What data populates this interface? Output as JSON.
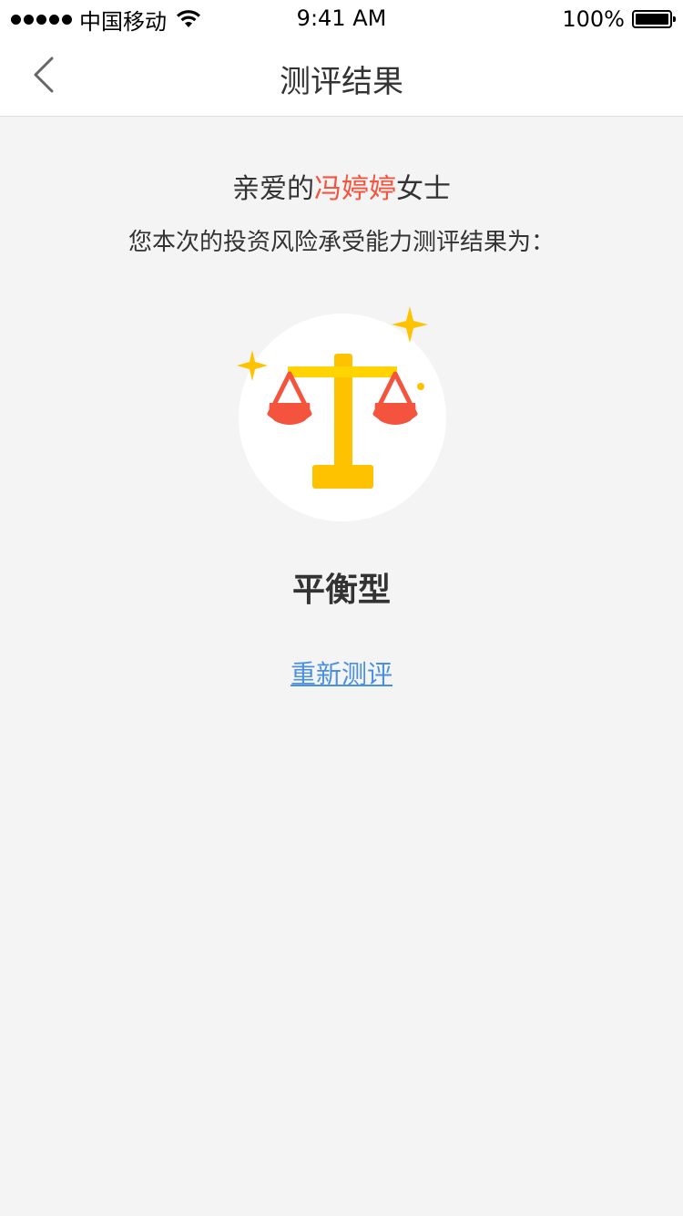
{
  "status_bar": {
    "carrier": "中国移动",
    "time": "9:41 AM",
    "battery": "100%"
  },
  "nav": {
    "title": "测评结果"
  },
  "greeting": {
    "prefix": "亲爱的",
    "name": "冯婷婷",
    "suffix": "女士"
  },
  "subtitle": "您本次的投资风险承受能力测评结果为：",
  "result": {
    "type": "平衡型",
    "icon": "balance-scale-icon"
  },
  "retest_label": "重新测评",
  "colors": {
    "accent_red": "#f4533d",
    "scale_yellow": "#ffc200",
    "link_blue": "#4a90e2"
  }
}
